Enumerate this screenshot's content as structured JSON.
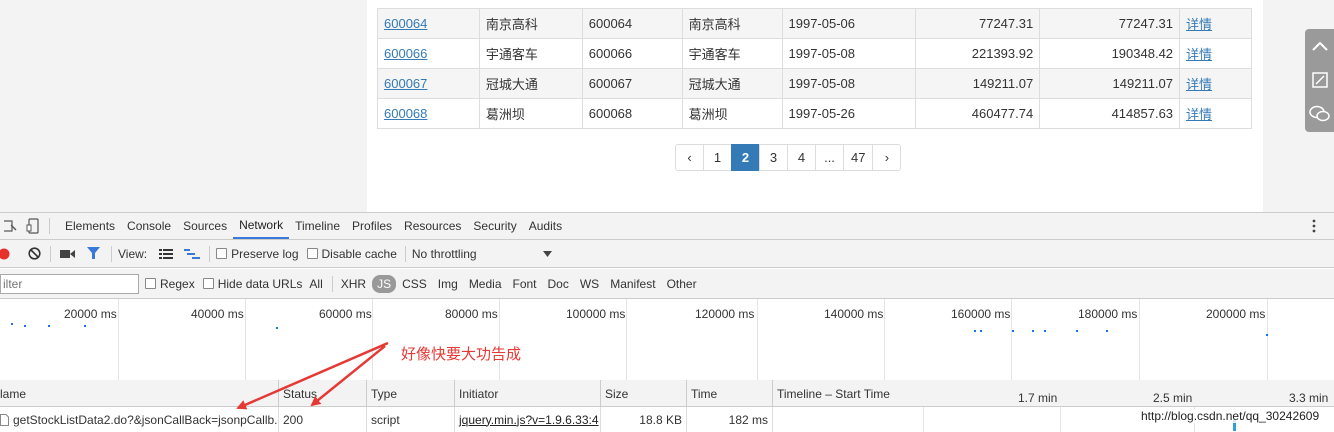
{
  "table": {
    "rows": [
      {
        "code": "600064",
        "name": "南京高科",
        "code2": "600064",
        "name2": "南京高科",
        "date": "1997-05-06",
        "v1": "77247.31",
        "v2": "77247.31",
        "link": "详情"
      },
      {
        "code": "600066",
        "name": "宇通客车",
        "code2": "600066",
        "name2": "宇通客车",
        "date": "1997-05-08",
        "v1": "221393.92",
        "v2": "190348.42",
        "link": "详情"
      },
      {
        "code": "600067",
        "name": "冠城大通",
        "code2": "600067",
        "name2": "冠城大通",
        "date": "1997-05-08",
        "v1": "149211.07",
        "v2": "149211.07",
        "link": "详情"
      },
      {
        "code": "600068",
        "name": "葛洲坝",
        "code2": "600068",
        "name2": "葛洲坝",
        "date": "1997-05-26",
        "v1": "460477.74",
        "v2": "414857.63",
        "link": "详情"
      }
    ]
  },
  "pagination": {
    "prev": "‹",
    "pages": [
      "1",
      "2",
      "3",
      "4",
      "...",
      "47"
    ],
    "active": "2",
    "next": "›"
  },
  "devtools": {
    "tabs": [
      "Elements",
      "Console",
      "Sources",
      "Network",
      "Timeline",
      "Profiles",
      "Resources",
      "Security",
      "Audits"
    ],
    "active_tab": "Network",
    "toolbar": {
      "view_label": "View:",
      "preserve_log": "Preserve log",
      "disable_cache": "Disable cache",
      "throttling": "No throttling"
    },
    "filter": {
      "placeholder": "ilter",
      "regex": "Regex",
      "hide_data_urls": "Hide data URLs",
      "types": [
        "All",
        "XHR",
        "JS",
        "CSS",
        "Img",
        "Media",
        "Font",
        "Doc",
        "WS",
        "Manifest",
        "Other"
      ],
      "active_type": "JS"
    },
    "timeline_ticks": [
      "20000 ms",
      "40000 ms",
      "60000 ms",
      "80000 ms",
      "100000 ms",
      "120000 ms",
      "140000 ms",
      "160000 ms",
      "180000 ms",
      "200000 ms"
    ],
    "columns": {
      "name": "lame",
      "status": "Status",
      "type": "Type",
      "initiator": "Initiator",
      "size": "Size",
      "time": "Time",
      "timeline": "Timeline – Start Time",
      "ticks": [
        "1.7 min",
        "2.5 min",
        "3.3 min"
      ]
    },
    "request": {
      "name": "getStockListData2.do?&jsonCallBack=jsonpCallb...",
      "status": "200",
      "type": "script",
      "initiator": "jquery.min.js?v=1.9.6.33:4",
      "size": "18.8 KB",
      "time": "182 ms"
    }
  },
  "annotation": "好像快要大功告成",
  "watermark": "http://blog.csdn.net/qq_30242609",
  "colors": {
    "link": "#337ab7",
    "active_page": "#337ab7",
    "record": "#e8302b",
    "annotation": "#e53935"
  }
}
